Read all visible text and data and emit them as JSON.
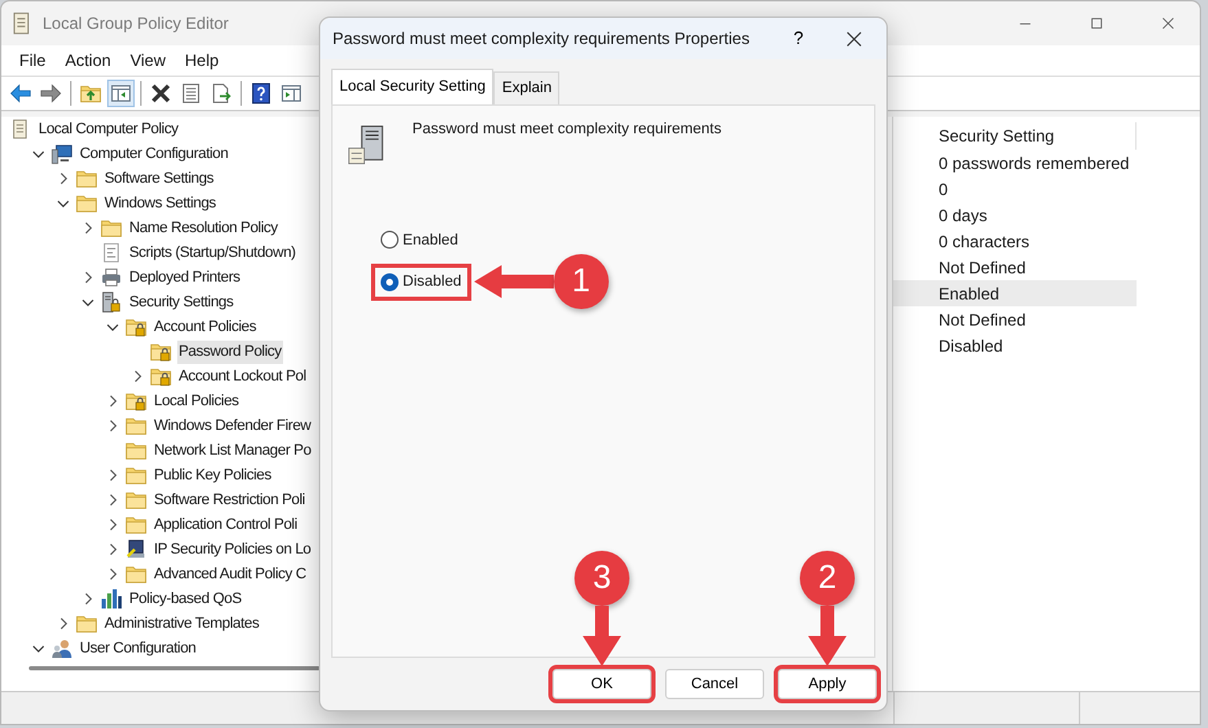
{
  "window": {
    "title": "Local Group Policy Editor"
  },
  "menu": [
    "File",
    "Action",
    "View",
    "Help"
  ],
  "tree": [
    {
      "label": "Local Computer Policy",
      "kind": "document",
      "selected": false,
      "children": [
        {
          "label": "Computer Configuration",
          "kind": "computer",
          "expanded": true,
          "selected": false,
          "children": [
            {
              "label": "Software Settings",
              "kind": "folder",
              "expanded": false,
              "selected": false
            },
            {
              "label": "Windows Settings",
              "kind": "folder",
              "expanded": true,
              "selected": false,
              "children": [
                {
                  "label": "Name Resolution Policy",
                  "kind": "folder",
                  "expanded": false,
                  "selected": false
                },
                {
                  "label": "Scripts (Startup/Shutdown)",
                  "kind": "script",
                  "selected": false
                },
                {
                  "label": "Deployed Printers",
                  "kind": "printer",
                  "expanded": false,
                  "selected": false
                },
                {
                  "label": "Security Settings",
                  "kind": "server",
                  "expanded": true,
                  "selected": false,
                  "children": [
                    {
                      "label": "Account Policies",
                      "kind": "locked-folder",
                      "expanded": true,
                      "selected": false,
                      "children": [
                        {
                          "label": "Password Policy",
                          "kind": "locked-folder",
                          "selected": true
                        },
                        {
                          "label": "Account Lockout Pol",
                          "kind": "locked-folder",
                          "expanded": false,
                          "selected": false
                        }
                      ]
                    },
                    {
                      "label": "Local Policies",
                      "kind": "locked-folder",
                      "expanded": false,
                      "selected": false
                    },
                    {
                      "label": "Windows Defender Firew",
                      "kind": "folder",
                      "expanded": false,
                      "selected": false
                    },
                    {
                      "label": "Network List Manager Po",
                      "kind": "folder",
                      "selected": false
                    },
                    {
                      "label": "Public Key Policies",
                      "kind": "folder",
                      "expanded": false,
                      "selected": false
                    },
                    {
                      "label": "Software Restriction Poli",
                      "kind": "folder",
                      "expanded": false,
                      "selected": false
                    },
                    {
                      "label": "Application Control Poli",
                      "kind": "folder",
                      "expanded": false,
                      "selected": false
                    },
                    {
                      "label": "IP Security Policies on Lo",
                      "kind": "network",
                      "expanded": false,
                      "selected": false
                    },
                    {
                      "label": "Advanced Audit Policy C",
                      "kind": "folder",
                      "expanded": false,
                      "selected": false
                    }
                  ]
                },
                {
                  "label": "Policy-based QoS",
                  "kind": "chart",
                  "expanded": false,
                  "selected": false
                }
              ]
            },
            {
              "label": "Administrative Templates",
              "kind": "folder",
              "expanded": false,
              "selected": false
            }
          ]
        },
        {
          "label": "User Configuration",
          "kind": "users",
          "expanded": true,
          "selected": false
        }
      ]
    }
  ],
  "settings_list": {
    "columns": [
      "Security Setting"
    ],
    "rows": [
      {
        "value": "0 passwords remembered",
        "selected": false
      },
      {
        "value": "0",
        "selected": false
      },
      {
        "value": "0 days",
        "selected": false
      },
      {
        "value": "0 characters",
        "selected": false
      },
      {
        "value": "Not Defined",
        "selected": false
      },
      {
        "value": "Enabled",
        "selected": true
      },
      {
        "value": "Not Defined",
        "selected": false
      },
      {
        "value": "Disabled",
        "selected": false
      }
    ]
  },
  "dialog": {
    "title": "Password must meet complexity requirements Properties",
    "help_button": "?",
    "tabs": [
      {
        "label": "Local Security Setting",
        "selected": true
      },
      {
        "label": "Explain",
        "selected": false
      }
    ],
    "policy_name": "Password must meet complexity requirements",
    "options": [
      {
        "label": "Enabled",
        "selected": false,
        "highlighted": false
      },
      {
        "label": "Disabled",
        "selected": true,
        "highlighted": true,
        "callout": {
          "number": "1"
        }
      }
    ],
    "buttons": [
      {
        "label": "OK",
        "highlighted": true,
        "callout": {
          "number": "3"
        }
      },
      {
        "label": "Cancel",
        "highlighted": false
      },
      {
        "label": "Apply",
        "highlighted": true,
        "callout": {
          "number": "2"
        }
      }
    ]
  }
}
